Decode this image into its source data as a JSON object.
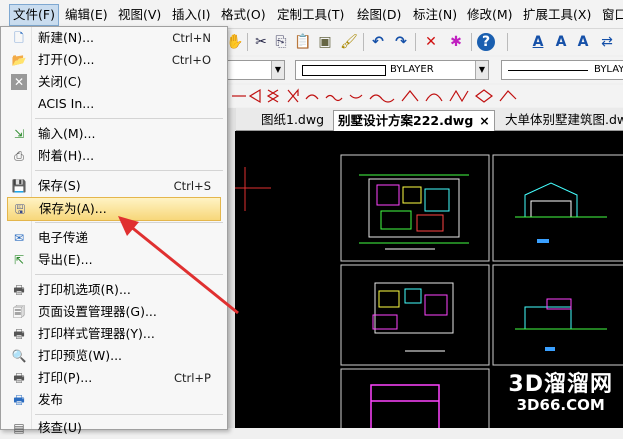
{
  "menubar": {
    "items": [
      "文件(F)",
      "编辑(E)",
      "视图(V)",
      "插入(I)",
      "格式(O)",
      "定制工具(T)",
      "绘图(D)",
      "标注(N)",
      "修改(M)",
      "扩展工具(X)",
      "窗口"
    ]
  },
  "toolbar": {
    "layer_combo": "BYLAYER",
    "linetype_combo": "BYLAYER"
  },
  "tabs": [
    {
      "label": "图纸1.dwg"
    },
    {
      "label": "别墅设计方案222.dwg",
      "close": "×"
    },
    {
      "label": "大单体别墅建筑图.dw"
    }
  ],
  "file_menu": {
    "items": [
      {
        "label": "新建(N)...",
        "shortcut": "Ctrl+N",
        "icon": "new-file-icon"
      },
      {
        "label": "打开(O)...",
        "shortcut": "Ctrl+O",
        "icon": "open-folder-icon"
      },
      {
        "label": "关闭(C)",
        "shortcut": "",
        "icon": "close-doc-icon"
      },
      {
        "label": "ACIS In...",
        "shortcut": "",
        "icon": ""
      },
      {
        "label": "输入(M)...",
        "shortcut": "",
        "icon": "import-icon"
      },
      {
        "label": "附着(H)...",
        "shortcut": "",
        "icon": "attach-icon"
      },
      {
        "label": "保存(S)",
        "shortcut": "Ctrl+S",
        "icon": "save-icon"
      },
      {
        "label": "保存为(A)...",
        "shortcut": "",
        "icon": "save-as-icon"
      },
      {
        "label": "电子传递",
        "shortcut": "",
        "icon": "etransmit-icon"
      },
      {
        "label": "导出(E)...",
        "shortcut": "",
        "icon": "export-icon"
      },
      {
        "label": "打印机选项(R)...",
        "shortcut": "",
        "icon": "printer-options-icon"
      },
      {
        "label": "页面设置管理器(G)...",
        "shortcut": "",
        "icon": "page-setup-icon"
      },
      {
        "label": "打印样式管理器(Y)...",
        "shortcut": "",
        "icon": "plot-style-icon"
      },
      {
        "label": "打印预览(W)...",
        "shortcut": "",
        "icon": "print-preview-icon"
      },
      {
        "label": "打印(P)...",
        "shortcut": "Ctrl+P",
        "icon": "print-icon"
      },
      {
        "label": "发布",
        "shortcut": "",
        "icon": "publish-icon"
      },
      {
        "label": "核查(U)",
        "shortcut": "",
        "icon": "audit-icon"
      }
    ]
  },
  "watermark": {
    "line1": "3D溜溜网",
    "line2": "3D66.COM"
  },
  "colors": {
    "highlight": "#f7d77a",
    "arrow": "#e03030",
    "canvas": "#000000"
  }
}
